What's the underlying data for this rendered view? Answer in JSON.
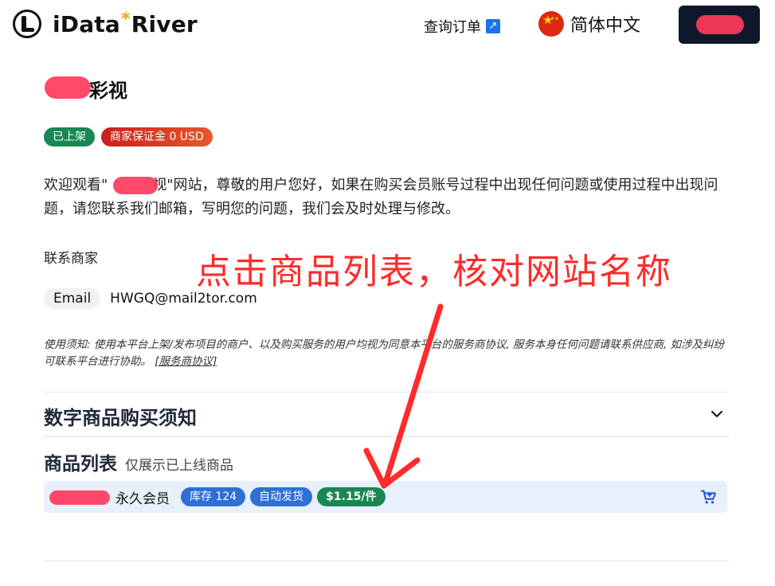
{
  "header": {
    "brand_prefix": "iData",
    "brand_star": "*",
    "brand_suffix": "River",
    "order_link": "查询订单",
    "language": "简体中文"
  },
  "store": {
    "title_suffix": "彩视",
    "status_badge": "已上架",
    "deposit_badge": "商家保证金 0 USD",
    "description_1": "欢迎观看\"",
    "description_2": "视\"网站，尊敬的用户您好，如果在购买会员账号过程中出现任何问题或使用过程中出现问题，请您联系我们邮箱，写明您的问题，我们会及时处理与修改。",
    "contact_title": "联系商家",
    "email_label": "Email",
    "email_value": "HWGQ@mail2tor.com",
    "notice_text": "使用须知: 使用本平台上架/发布项目的商户、以及购买服务的用户均视为同意本平台的服务商协议, 服务本身任何问题请联系供应商, 如涉及纠纷可联系平台进行协助。",
    "notice_link": "[服务商协议]"
  },
  "digital_notice": {
    "title": "数字商品购买须知"
  },
  "product_list": {
    "title": "商品列表",
    "subtitle": "仅展示已上线商品",
    "items": [
      {
        "name": "永久会员",
        "stock": "库存 124",
        "delivery": "自动发货",
        "price": "$1.15/件"
      }
    ]
  },
  "annotation": {
    "text": "点击商品列表，核对网站名称",
    "color": "#ff2a2a"
  },
  "colors": {
    "accent_green": "#198754",
    "accent_blue": "#2f6fd6",
    "redaction": "#ff3b5c"
  }
}
